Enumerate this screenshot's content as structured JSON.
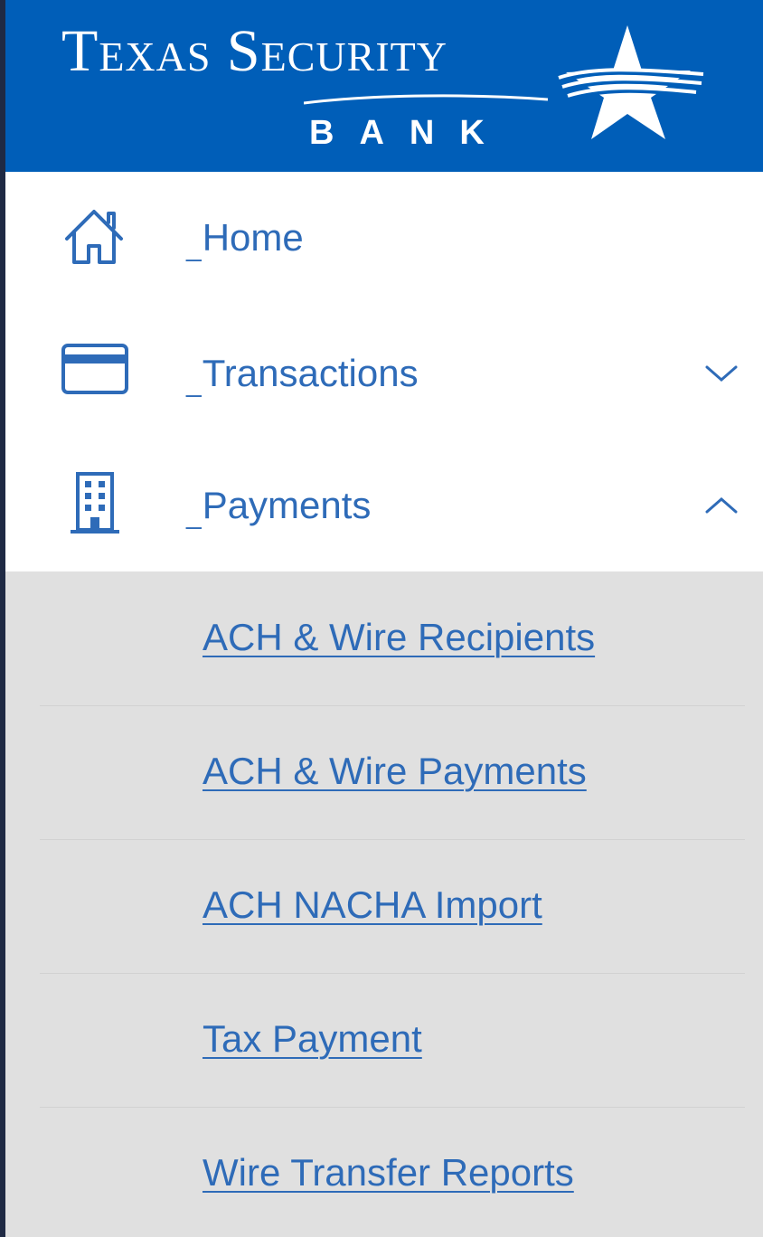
{
  "brand": {
    "name_line1": "Texas Security",
    "name_line2": "BANK",
    "header_color": "#005eb8"
  },
  "nav": {
    "items": [
      {
        "label": "Home",
        "icon": "home-icon",
        "chevron": null
      },
      {
        "label": "Transactions",
        "icon": "credit-card-icon",
        "chevron": "chevron-down-icon"
      },
      {
        "label": "Payments",
        "icon": "building-icon",
        "chevron": "chevron-up-icon",
        "expanded": true
      }
    ]
  },
  "payments_submenu": {
    "items": [
      {
        "label": "ACH & Wire Recipients"
      },
      {
        "label": "ACH & Wire Payments"
      },
      {
        "label": "ACH NACHA Import"
      },
      {
        "label": "Tax Payment"
      },
      {
        "label": "Wire Transfer Reports"
      }
    ]
  },
  "colors": {
    "link": "#2e6bb8",
    "submenu_bg": "#e0e0e0"
  }
}
